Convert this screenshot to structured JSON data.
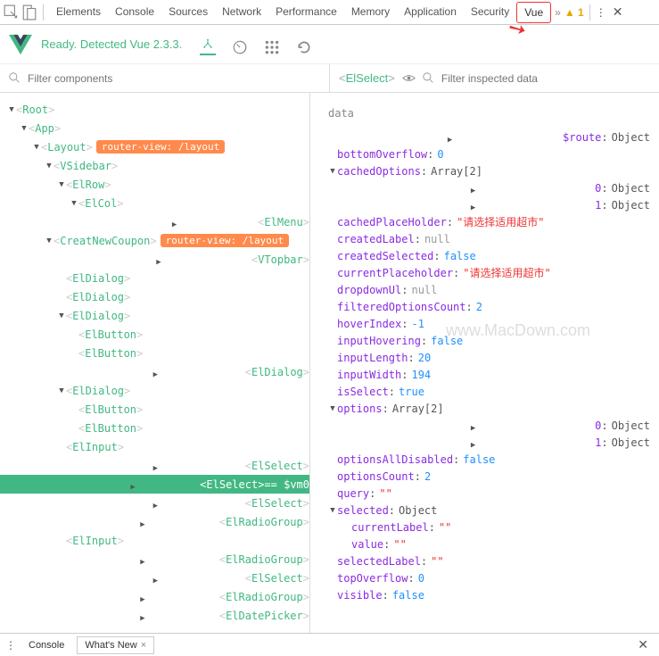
{
  "topbar": {
    "tabs": [
      "Elements",
      "Console",
      "Sources",
      "Network",
      "Performance",
      "Memory",
      "Application",
      "Security",
      "Vue"
    ],
    "active": "Vue",
    "warn_count": "1"
  },
  "status": {
    "text": "Ready. Detected Vue 2.3.3."
  },
  "filter": {
    "components_ph": "Filter components",
    "inspected_ph": "Filter inspected data",
    "selected": "ElSelect"
  },
  "tree": [
    {
      "d": 0,
      "c": "down",
      "n": "Root"
    },
    {
      "d": 1,
      "c": "down",
      "n": "App"
    },
    {
      "d": 2,
      "c": "down",
      "n": "Layout",
      "b": "router-view: /layout"
    },
    {
      "d": 3,
      "c": "down",
      "n": "VSidebar"
    },
    {
      "d": 4,
      "c": "down",
      "n": "ElRow"
    },
    {
      "d": 5,
      "c": "down",
      "n": "ElCol"
    },
    {
      "d": 6,
      "c": "right",
      "n": "ElMenu"
    },
    {
      "d": 3,
      "c": "down",
      "n": "CreatNewCoupon",
      "b": "router-view: /layout"
    },
    {
      "d": 4,
      "c": "right",
      "n": "VTopbar"
    },
    {
      "d": 4,
      "c": "none",
      "n": "ElDialog"
    },
    {
      "d": 4,
      "c": "none",
      "n": "ElDialog"
    },
    {
      "d": 4,
      "c": "down",
      "n": "ElDialog"
    },
    {
      "d": 5,
      "c": "none",
      "n": "ElButton"
    },
    {
      "d": 5,
      "c": "none",
      "n": "ElButton"
    },
    {
      "d": 4,
      "c": "right",
      "n": "ElDialog"
    },
    {
      "d": 4,
      "c": "down",
      "n": "ElDialog"
    },
    {
      "d": 5,
      "c": "none",
      "n": "ElButton"
    },
    {
      "d": 5,
      "c": "none",
      "n": "ElButton"
    },
    {
      "d": 4,
      "c": "none",
      "n": "ElInput"
    },
    {
      "d": 4,
      "c": "right",
      "n": "ElSelect"
    },
    {
      "d": 4,
      "c": "right",
      "n": "ElSelect",
      "sel": true,
      "vm": " == $vm0"
    },
    {
      "d": 4,
      "c": "right",
      "n": "ElSelect"
    },
    {
      "d": 4,
      "c": "right",
      "n": "ElRadioGroup"
    },
    {
      "d": 4,
      "c": "none",
      "n": "ElInput"
    },
    {
      "d": 4,
      "c": "right",
      "n": "ElRadioGroup"
    },
    {
      "d": 4,
      "c": "right",
      "n": "ElSelect"
    },
    {
      "d": 4,
      "c": "right",
      "n": "ElRadioGroup"
    },
    {
      "d": 4,
      "c": "right",
      "n": "ElDatePicker"
    }
  ],
  "data_label": "data",
  "props": [
    {
      "d": 0,
      "c": "right",
      "k": "$route",
      "t": "obj",
      "v": "Object"
    },
    {
      "d": 0,
      "c": "none",
      "k": "bottomOverflow",
      "t": "num",
      "v": "0"
    },
    {
      "d": 0,
      "c": "down",
      "k": "cachedOptions",
      "t": "obj",
      "v": "Array[2]"
    },
    {
      "d": 1,
      "c": "right",
      "k": "0",
      "t": "obj",
      "v": "Object"
    },
    {
      "d": 1,
      "c": "right",
      "k": "1",
      "t": "obj",
      "v": "Object"
    },
    {
      "d": 0,
      "c": "none",
      "k": "cachedPlaceHolder",
      "t": "str",
      "v": "\"请选择适用超市\""
    },
    {
      "d": 0,
      "c": "none",
      "k": "createdLabel",
      "t": "null",
      "v": "null"
    },
    {
      "d": 0,
      "c": "none",
      "k": "createdSelected",
      "t": "bool",
      "v": "false"
    },
    {
      "d": 0,
      "c": "none",
      "k": "currentPlaceholder",
      "t": "str",
      "v": "\"请选择适用超市\""
    },
    {
      "d": 0,
      "c": "none",
      "k": "dropdownUl",
      "t": "null",
      "v": "null"
    },
    {
      "d": 0,
      "c": "none",
      "k": "filteredOptionsCount",
      "t": "num",
      "v": "2"
    },
    {
      "d": 0,
      "c": "none",
      "k": "hoverIndex",
      "t": "num",
      "v": "-1"
    },
    {
      "d": 0,
      "c": "none",
      "k": "inputHovering",
      "t": "bool",
      "v": "false"
    },
    {
      "d": 0,
      "c": "none",
      "k": "inputLength",
      "t": "num",
      "v": "20"
    },
    {
      "d": 0,
      "c": "none",
      "k": "inputWidth",
      "t": "num",
      "v": "194"
    },
    {
      "d": 0,
      "c": "none",
      "k": "isSelect",
      "t": "bool",
      "v": "true"
    },
    {
      "d": 0,
      "c": "down",
      "k": "options",
      "t": "obj",
      "v": "Array[2]"
    },
    {
      "d": 1,
      "c": "right",
      "k": "0",
      "t": "obj",
      "v": "Object"
    },
    {
      "d": 1,
      "c": "right",
      "k": "1",
      "t": "obj",
      "v": "Object"
    },
    {
      "d": 0,
      "c": "none",
      "k": "optionsAllDisabled",
      "t": "bool",
      "v": "false"
    },
    {
      "d": 0,
      "c": "none",
      "k": "optionsCount",
      "t": "num",
      "v": "2"
    },
    {
      "d": 0,
      "c": "none",
      "k": "query",
      "t": "str",
      "v": "\"\""
    },
    {
      "d": 0,
      "c": "down",
      "k": "selected",
      "t": "obj",
      "v": "Object"
    },
    {
      "d": 1,
      "c": "none",
      "k": "currentLabel",
      "t": "str",
      "v": "\"\""
    },
    {
      "d": 1,
      "c": "none",
      "k": "value",
      "t": "str",
      "v": "\"\""
    },
    {
      "d": 0,
      "c": "none",
      "k": "selectedLabel",
      "t": "str",
      "v": "\"\""
    },
    {
      "d": 0,
      "c": "none",
      "k": "topOverflow",
      "t": "num",
      "v": "0"
    },
    {
      "d": 0,
      "c": "none",
      "k": "visible",
      "t": "bool",
      "v": "false"
    }
  ],
  "bottom": {
    "console": "Console",
    "whatsnew": "What's New"
  },
  "watermark": "www.MacDown.com"
}
